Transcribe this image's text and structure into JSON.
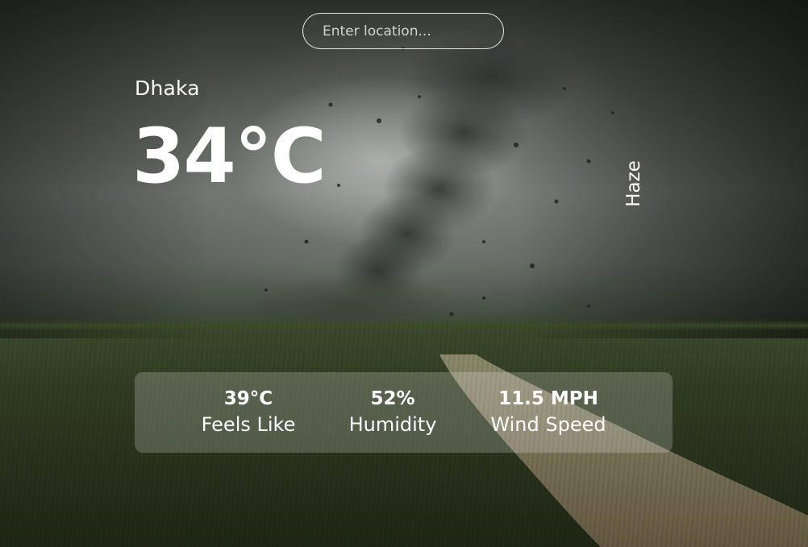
{
  "search": {
    "placeholder": "Enter location...",
    "value": ""
  },
  "weather": {
    "city": "Dhaka",
    "temperature": "34°C",
    "condition": "Haze"
  },
  "stats": {
    "feels_like": {
      "value": "39°C",
      "label": "Feels Like"
    },
    "humidity": {
      "value": "52%",
      "label": "Humidity"
    },
    "wind_speed": {
      "value": "11.5 MPH",
      "label": "Wind Speed"
    }
  },
  "colors": {
    "text": "#ffffff",
    "panel": "rgba(255,255,255,0.2)",
    "sky": "#6f746f",
    "field": "#2f3b22"
  }
}
